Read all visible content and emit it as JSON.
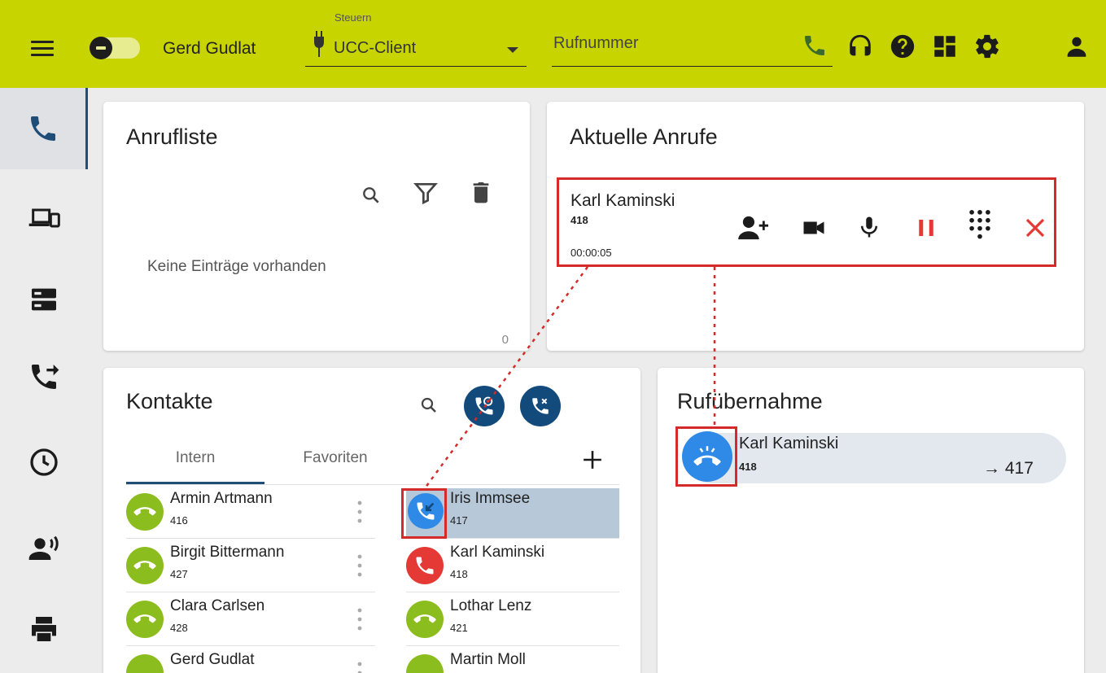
{
  "header": {
    "user_name": "Gerd Gudlat",
    "control_label": "Steuern",
    "control_value": "UCC-Client",
    "phone_placeholder": "Rufnummer",
    "icons": [
      "phone-icon",
      "headset-icon",
      "help-icon",
      "dashboard-icon",
      "settings-icon",
      "account-icon"
    ]
  },
  "sidebar": {
    "items": [
      {
        "icon": "phone-icon",
        "active": true
      },
      {
        "icon": "devices-icon",
        "active": false
      },
      {
        "icon": "server-icon",
        "active": false
      },
      {
        "icon": "call-forward-icon",
        "active": false
      },
      {
        "icon": "clock-icon",
        "active": false
      },
      {
        "icon": "voice-user-icon",
        "active": false
      },
      {
        "icon": "printer-icon",
        "active": false
      }
    ]
  },
  "call_list": {
    "title": "Anrufliste",
    "empty_text": "Keine Einträge vorhanden",
    "count": "0"
  },
  "current_calls": {
    "title": "Aktuelle Anrufe",
    "call": {
      "name": "Karl Kaminski",
      "number": "418",
      "duration": "00:00:05"
    },
    "actions": [
      "add-participant-icon",
      "video-icon",
      "microphone-icon",
      "pause-icon",
      "dialpad-icon",
      "hangup-icon"
    ]
  },
  "contacts": {
    "title": "Kontakte",
    "tabs": [
      {
        "label": "Intern",
        "active": true
      },
      {
        "label": "Favoriten",
        "active": false
      }
    ],
    "left_column": [
      {
        "name": "Armin Artmann",
        "number": "416",
        "status": "available"
      },
      {
        "name": "Birgit Bittermann",
        "number": "427",
        "status": "available"
      },
      {
        "name": "Clara Carlsen",
        "number": "428",
        "status": "available"
      },
      {
        "name": "Gerd Gudlat",
        "number": "",
        "status": "available"
      }
    ],
    "right_column": [
      {
        "name": "Iris Immsee",
        "number": "417",
        "status": "ringing",
        "selected": true
      },
      {
        "name": "Karl Kaminski",
        "number": "418",
        "status": "busy",
        "selected": false
      },
      {
        "name": "Lothar Lenz",
        "number": "421",
        "status": "available",
        "selected": false
      },
      {
        "name": "Martin Moll",
        "number": "",
        "status": "available",
        "selected": false
      }
    ]
  },
  "pickup": {
    "title": "Rufübernahme",
    "name": "Karl Kaminski",
    "number": "418",
    "target": "→ 417"
  },
  "colors": {
    "header_bg": "#c8d400",
    "accent_blue": "#124a7c",
    "available_green": "#8cbd1e",
    "busy_red": "#e53935",
    "ringing_blue": "#2e8ae6",
    "highlight_red": "#d42a2a"
  }
}
